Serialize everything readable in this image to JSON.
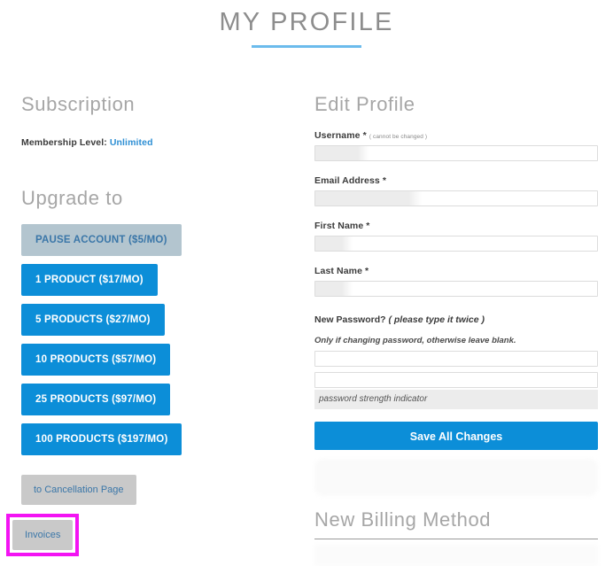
{
  "page": {
    "title": "MY PROFILE"
  },
  "subscription": {
    "heading": "Subscription",
    "membership_label": "Membership Level:",
    "membership_value": "Unlimited",
    "upgrade_heading": "Upgrade to",
    "plans": [
      {
        "label": "PAUSE ACCOUNT ($5/MO)",
        "style": "pause"
      },
      {
        "label": "1 PRODUCT ($17/MO)",
        "style": "blue"
      },
      {
        "label": "5 PRODUCTS ($27/MO)",
        "style": "blue"
      },
      {
        "label": "10 PRODUCTS ($57/MO)",
        "style": "blue"
      },
      {
        "label": "25 PRODUCTS ($97/MO)",
        "style": "blue"
      },
      {
        "label": "100 PRODUCTS ($197/MO)",
        "style": "blue"
      }
    ],
    "cancellation_label": "to Cancellation Page",
    "invoices_label": "Invoices"
  },
  "edit_profile": {
    "heading": "Edit Profile",
    "username_label": "Username *",
    "username_hint": "( cannot be changed )",
    "username_value": "",
    "email_label": "Email Address *",
    "email_value": "",
    "first_name_label": "First Name *",
    "first_name_value": "",
    "last_name_label": "Last Name *",
    "last_name_value": "",
    "new_password_label": "New Password?",
    "new_password_hint": "( please type it twice )",
    "password_note": "Only if changing password, otherwise leave blank.",
    "password_value": "",
    "password_confirm_value": "",
    "password_strength_text": "password strength indicator",
    "save_label": "Save All Changes"
  },
  "billing": {
    "heading": "New Billing Method"
  },
  "colors": {
    "accent_blue": "#0c8ed8",
    "title_rule": "#6bbbec",
    "heading_gray": "#a6a6a6",
    "pause_gray": "#b3c5cf",
    "secondary_gray": "#c9c9c9",
    "highlight_magenta": "#f313f3",
    "link_blue": "#3a76a8"
  }
}
